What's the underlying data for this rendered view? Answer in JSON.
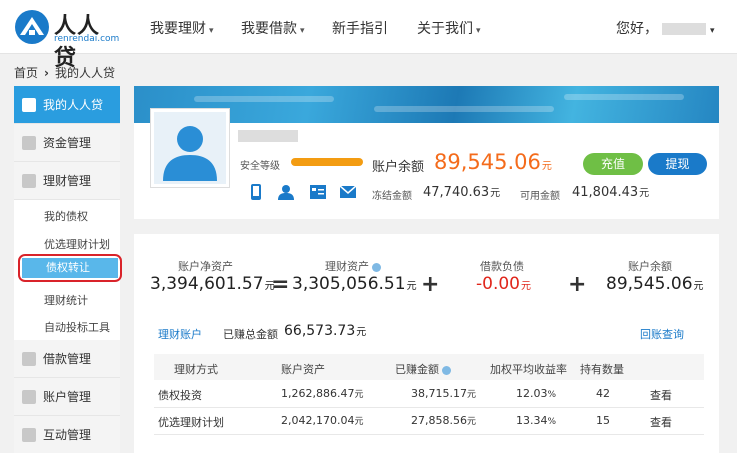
{
  "brand": {
    "name": "人人贷",
    "domain": "renrendai.com"
  },
  "nav": {
    "items": [
      {
        "label": "我要理财",
        "caret": "▾"
      },
      {
        "label": "我要借款",
        "caret": "▾"
      },
      {
        "label": "新手指引",
        "caret": ""
      },
      {
        "label": "关于我们",
        "caret": "▾"
      }
    ],
    "greeting": "您好，",
    "greeting_caret": "▾"
  },
  "breadcrumb": {
    "home": "首页",
    "sep": "›",
    "current": "我的人人贷"
  },
  "sidebar": {
    "items": [
      {
        "label": "我的人人贷",
        "icon": "home-icon"
      },
      {
        "label": "资金管理",
        "icon": "database-icon"
      },
      {
        "label": "理财管理",
        "icon": "bar-chart-icon"
      },
      {
        "label": "借款管理",
        "icon": "calculator-icon"
      },
      {
        "label": "账户管理",
        "icon": "user-icon"
      },
      {
        "label": "互动管理",
        "icon": "refresh-icon"
      }
    ],
    "sub_items": [
      "我的债权",
      "优选理财计划",
      "债权转让",
      "理财统计",
      "自动投标工具"
    ],
    "active_sub": "债权转让"
  },
  "profile": {
    "security_label": "安全等级",
    "balance_label": "账户余额",
    "balance_value": "89,545.06",
    "unit": "元",
    "recharge_label": "充值",
    "withdraw_label": "提现",
    "frozen_label": "冻结金额",
    "frozen_value": "47,740.63",
    "available_label": "可用金额",
    "available_value": "41,804.43",
    "icons": [
      "phone-icon",
      "person-icon",
      "bank-card-icon",
      "email-icon"
    ]
  },
  "summary": {
    "net_assets_label": "账户净资产",
    "net_assets_value": "3,394,601.57",
    "op_equals": "=",
    "finance_assets_label": "理财资产",
    "finance_assets_value": "3,305,056.51",
    "op_plus1": "+",
    "loan_debt_label": "借款负债",
    "loan_debt_value": "-0.00",
    "op_plus2": "+",
    "balance_label": "账户余额",
    "balance_value": "89,545.06",
    "unit": "元"
  },
  "earnings": {
    "tab_label": "理财账户",
    "total_label": "已赚总金额",
    "total_value": "66,573.73",
    "query_label": "回账查询"
  },
  "table": {
    "headers": [
      "理财方式",
      "账户资产",
      "已赚金额",
      "加权平均收益率",
      "持有数量",
      ""
    ],
    "rows": [
      {
        "type": "债权投资",
        "assets": "1,262,886.47",
        "earned": "38,715.17",
        "rate": "12.03",
        "count": "42",
        "action": "查看"
      },
      {
        "type": "优选理财计划",
        "assets": "2,042,170.04",
        "earned": "27,858.56",
        "rate": "13.34",
        "count": "15",
        "action": "查看"
      }
    ],
    "unit": "元",
    "pct": "%"
  },
  "colors": {
    "accent": "#2a9ddf",
    "orange": "#f46b1b",
    "green": "#6fbf45",
    "blue": "#1a7ac9",
    "red": "#e0261b"
  }
}
